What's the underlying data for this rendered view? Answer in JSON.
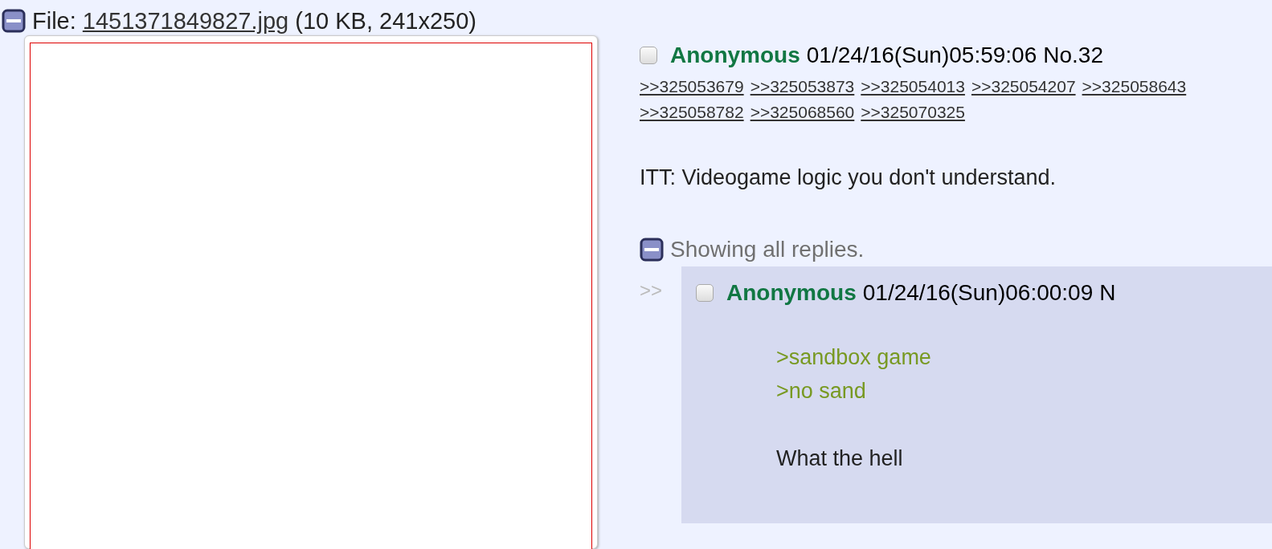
{
  "file_info": {
    "label": "File:",
    "filename": "1451371849827.jpg",
    "meta": "(10 KB, 241x250)",
    "collapsed": false
  },
  "post": {
    "checked": false,
    "name": "Anonymous",
    "datetime": "01/24/16(Sun)05:59:06",
    "number": "No.32",
    "backlinks": [
      ">>325053679",
      ">>325053873",
      ">>325054013",
      ">>325054207",
      ">>325058643",
      ">>325058782",
      ">>325068560",
      ">>325070325"
    ],
    "message": "ITT: Videogame logic you don't understand."
  },
  "replies_toggle": {
    "label": "Showing all replies.",
    "collapsed": false
  },
  "replies": [
    {
      "arrow": ">>",
      "checked": false,
      "name": "Anonymous",
      "datetime": "01/24/16(Sun)06:00:09",
      "number": "N",
      "blocks": [
        {
          "kind": "quote",
          "lines": [
            ">sandbox game",
            ">no sand"
          ]
        },
        {
          "kind": "text",
          "lines": [
            "What the hell"
          ]
        }
      ]
    }
  ]
}
